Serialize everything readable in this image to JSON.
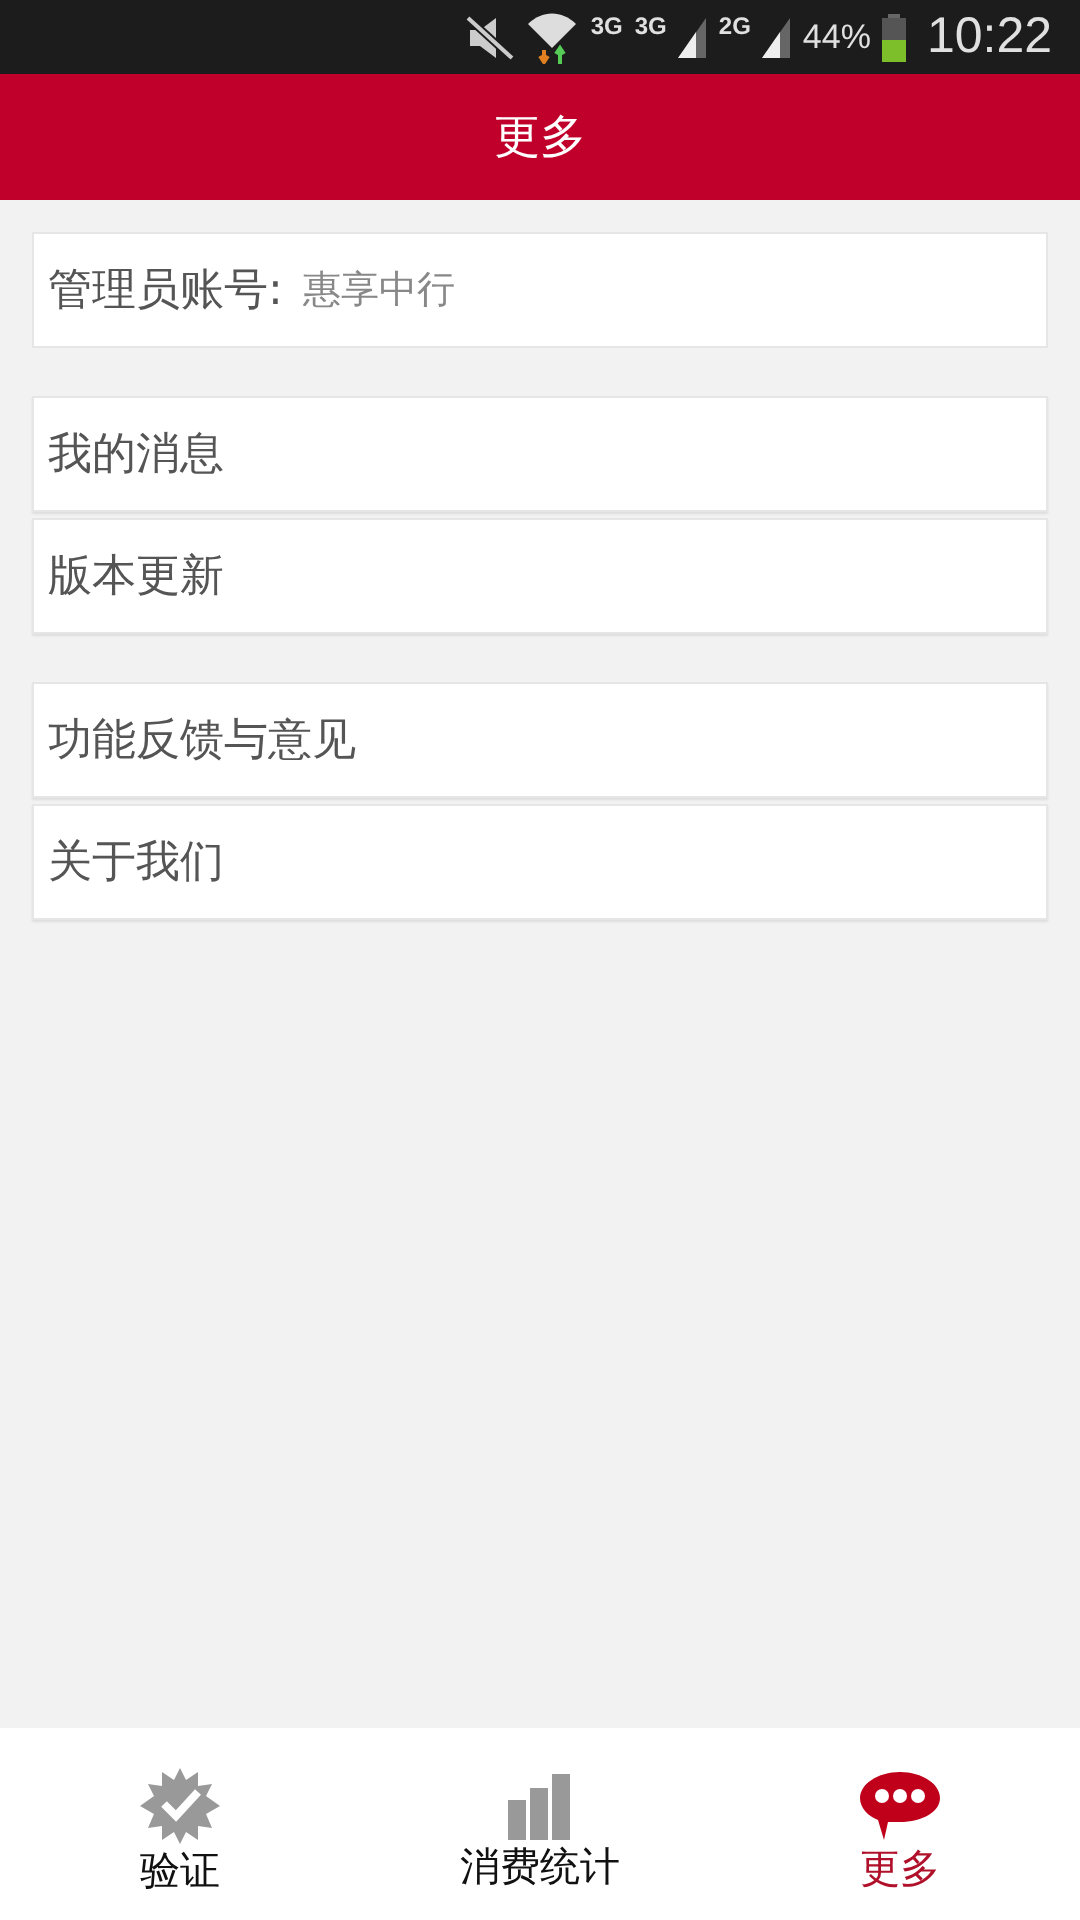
{
  "status_bar": {
    "network_1": "3G",
    "network_2": "3G",
    "network_3": "2G",
    "battery": "44%",
    "time": "10:22"
  },
  "header": {
    "title": "更多"
  },
  "account": {
    "label": "管理员账号:",
    "value": "惠享中行"
  },
  "groups": [
    {
      "items": [
        "我的消息",
        "版本更新"
      ]
    },
    {
      "items": [
        "功能反馈与意见",
        "关于我们"
      ]
    }
  ],
  "tabs": [
    {
      "label": "验证",
      "kind": "verify",
      "selected": false
    },
    {
      "label": "消费统计",
      "kind": "stats",
      "selected": false
    },
    {
      "label": "更多",
      "kind": "more",
      "selected": true
    }
  ]
}
